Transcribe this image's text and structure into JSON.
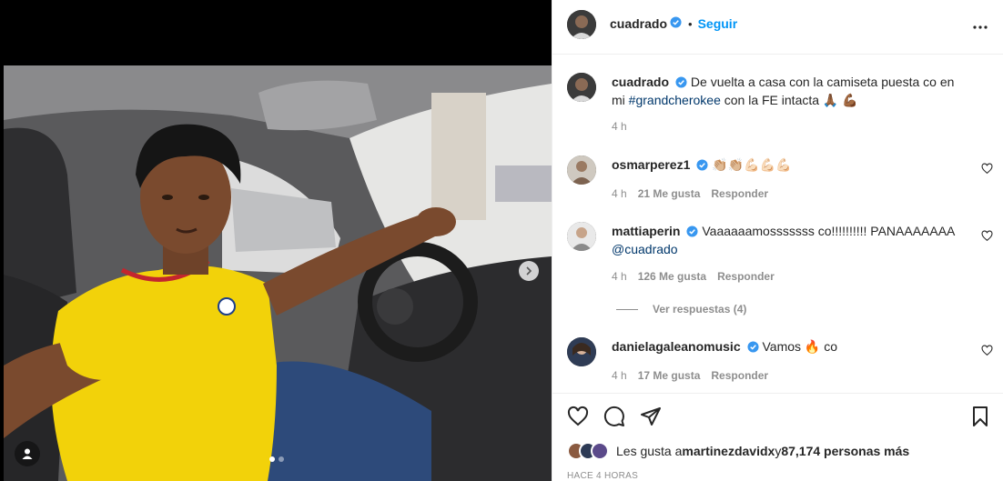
{
  "post": {
    "username": "cuadrado",
    "separator": "•",
    "follow_label": "Seguir",
    "more_icon": "more-icon"
  },
  "caption": {
    "username": "cuadrado",
    "text_part1": "De vuelta a casa con la camiseta puesta co en mi ",
    "hashtag": "#grandcherokee",
    "text_part2": " con la FE intacta 🙏🏾 💪🏾",
    "time": "4 h"
  },
  "comments": [
    {
      "username": "osmarperez1",
      "text": "👏🏼👏🏼💪🏻💪🏻💪🏻",
      "time": "4 h",
      "likes": "21 Me gusta",
      "reply": "Responder"
    },
    {
      "username": "mattiaperin",
      "text": "Vaaaaaamosssssss co!!!!!!!!!! PANAAAAAAA ",
      "mention": "@cuadrado",
      "time": "4 h",
      "likes": "126 Me gusta",
      "reply": "Responder"
    },
    {
      "username": "danielagaleanomusic",
      "text": "Vamos 🔥 co",
      "time": "4 h",
      "likes": "17 Me gusta",
      "reply": "Responder"
    }
  ],
  "view_replies": "Ver respuestas (4)",
  "likes": {
    "prefix": "Les gusta a ",
    "user": "martinezdavidx",
    "middle": " y ",
    "count": "87,174 personas más"
  },
  "time_ago": "HACE 4 HORAS",
  "colors": {
    "accent": "#0095f6",
    "verified": "#3897f0",
    "jersey": "#f5d60a"
  }
}
